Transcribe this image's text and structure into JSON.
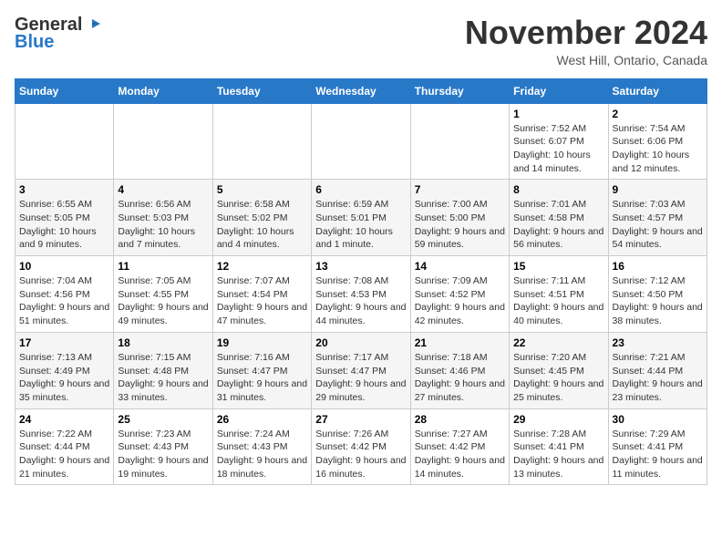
{
  "header": {
    "logo_line1": "General",
    "logo_line2": "Blue",
    "month": "November 2024",
    "location": "West Hill, Ontario, Canada"
  },
  "columns": [
    "Sunday",
    "Monday",
    "Tuesday",
    "Wednesday",
    "Thursday",
    "Friday",
    "Saturday"
  ],
  "weeks": [
    [
      {
        "day": "",
        "info": ""
      },
      {
        "day": "",
        "info": ""
      },
      {
        "day": "",
        "info": ""
      },
      {
        "day": "",
        "info": ""
      },
      {
        "day": "",
        "info": ""
      },
      {
        "day": "1",
        "info": "Sunrise: 7:52 AM\nSunset: 6:07 PM\nDaylight: 10 hours and 14 minutes."
      },
      {
        "day": "2",
        "info": "Sunrise: 7:54 AM\nSunset: 6:06 PM\nDaylight: 10 hours and 12 minutes."
      }
    ],
    [
      {
        "day": "3",
        "info": "Sunrise: 6:55 AM\nSunset: 5:05 PM\nDaylight: 10 hours and 9 minutes."
      },
      {
        "day": "4",
        "info": "Sunrise: 6:56 AM\nSunset: 5:03 PM\nDaylight: 10 hours and 7 minutes."
      },
      {
        "day": "5",
        "info": "Sunrise: 6:58 AM\nSunset: 5:02 PM\nDaylight: 10 hours and 4 minutes."
      },
      {
        "day": "6",
        "info": "Sunrise: 6:59 AM\nSunset: 5:01 PM\nDaylight: 10 hours and 1 minute."
      },
      {
        "day": "7",
        "info": "Sunrise: 7:00 AM\nSunset: 5:00 PM\nDaylight: 9 hours and 59 minutes."
      },
      {
        "day": "8",
        "info": "Sunrise: 7:01 AM\nSunset: 4:58 PM\nDaylight: 9 hours and 56 minutes."
      },
      {
        "day": "9",
        "info": "Sunrise: 7:03 AM\nSunset: 4:57 PM\nDaylight: 9 hours and 54 minutes."
      }
    ],
    [
      {
        "day": "10",
        "info": "Sunrise: 7:04 AM\nSunset: 4:56 PM\nDaylight: 9 hours and 51 minutes."
      },
      {
        "day": "11",
        "info": "Sunrise: 7:05 AM\nSunset: 4:55 PM\nDaylight: 9 hours and 49 minutes."
      },
      {
        "day": "12",
        "info": "Sunrise: 7:07 AM\nSunset: 4:54 PM\nDaylight: 9 hours and 47 minutes."
      },
      {
        "day": "13",
        "info": "Sunrise: 7:08 AM\nSunset: 4:53 PM\nDaylight: 9 hours and 44 minutes."
      },
      {
        "day": "14",
        "info": "Sunrise: 7:09 AM\nSunset: 4:52 PM\nDaylight: 9 hours and 42 minutes."
      },
      {
        "day": "15",
        "info": "Sunrise: 7:11 AM\nSunset: 4:51 PM\nDaylight: 9 hours and 40 minutes."
      },
      {
        "day": "16",
        "info": "Sunrise: 7:12 AM\nSunset: 4:50 PM\nDaylight: 9 hours and 38 minutes."
      }
    ],
    [
      {
        "day": "17",
        "info": "Sunrise: 7:13 AM\nSunset: 4:49 PM\nDaylight: 9 hours and 35 minutes."
      },
      {
        "day": "18",
        "info": "Sunrise: 7:15 AM\nSunset: 4:48 PM\nDaylight: 9 hours and 33 minutes."
      },
      {
        "day": "19",
        "info": "Sunrise: 7:16 AM\nSunset: 4:47 PM\nDaylight: 9 hours and 31 minutes."
      },
      {
        "day": "20",
        "info": "Sunrise: 7:17 AM\nSunset: 4:47 PM\nDaylight: 9 hours and 29 minutes."
      },
      {
        "day": "21",
        "info": "Sunrise: 7:18 AM\nSunset: 4:46 PM\nDaylight: 9 hours and 27 minutes."
      },
      {
        "day": "22",
        "info": "Sunrise: 7:20 AM\nSunset: 4:45 PM\nDaylight: 9 hours and 25 minutes."
      },
      {
        "day": "23",
        "info": "Sunrise: 7:21 AM\nSunset: 4:44 PM\nDaylight: 9 hours and 23 minutes."
      }
    ],
    [
      {
        "day": "24",
        "info": "Sunrise: 7:22 AM\nSunset: 4:44 PM\nDaylight: 9 hours and 21 minutes."
      },
      {
        "day": "25",
        "info": "Sunrise: 7:23 AM\nSunset: 4:43 PM\nDaylight: 9 hours and 19 minutes."
      },
      {
        "day": "26",
        "info": "Sunrise: 7:24 AM\nSunset: 4:43 PM\nDaylight: 9 hours and 18 minutes."
      },
      {
        "day": "27",
        "info": "Sunrise: 7:26 AM\nSunset: 4:42 PM\nDaylight: 9 hours and 16 minutes."
      },
      {
        "day": "28",
        "info": "Sunrise: 7:27 AM\nSunset: 4:42 PM\nDaylight: 9 hours and 14 minutes."
      },
      {
        "day": "29",
        "info": "Sunrise: 7:28 AM\nSunset: 4:41 PM\nDaylight: 9 hours and 13 minutes."
      },
      {
        "day": "30",
        "info": "Sunrise: 7:29 AM\nSunset: 4:41 PM\nDaylight: 9 hours and 11 minutes."
      }
    ]
  ]
}
